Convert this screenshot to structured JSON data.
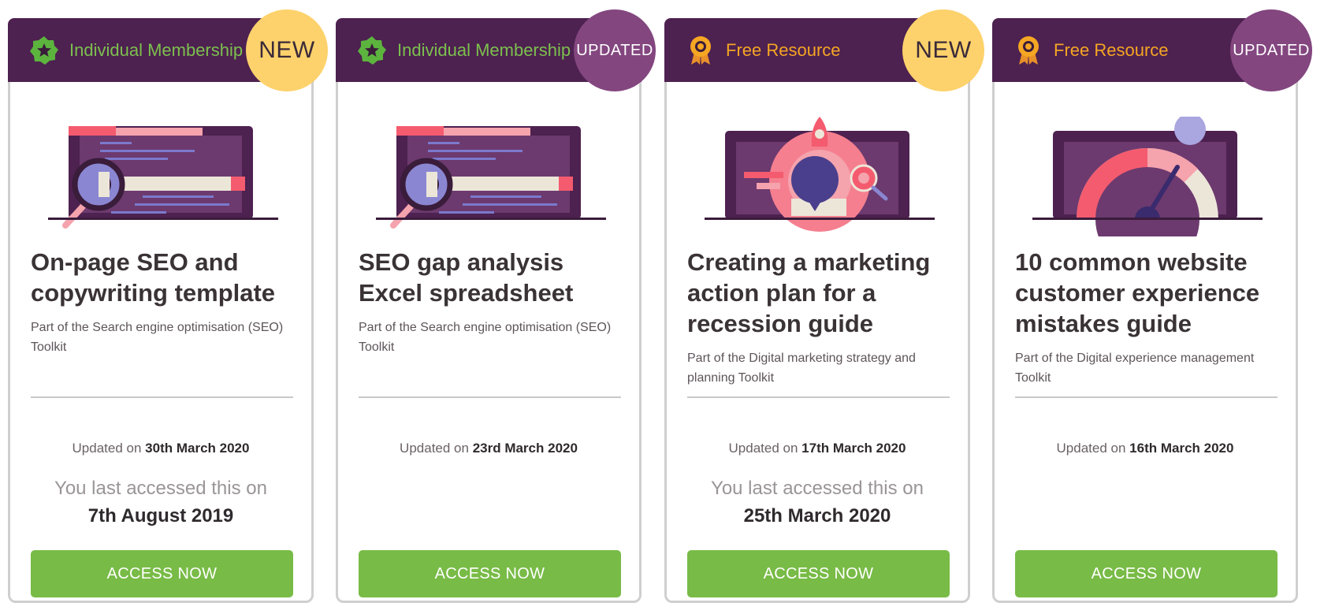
{
  "cards": [
    {
      "type_label": "Individual Membership",
      "type_icon": "star-badge-icon",
      "badge": "NEW",
      "illustration": "seo-magnifier-illustration",
      "title": "On-page SEO and copywriting template",
      "subtitle": "Part of the Search engine optimisation (SEO) Toolkit",
      "updated_prefix": "Updated on",
      "updated_date": "30th March 2020",
      "accessed_text": "You last accessed this on",
      "accessed_date": "7th August 2019",
      "button_label": "ACCESS NOW"
    },
    {
      "type_label": "Individual Membership",
      "type_icon": "star-badge-icon",
      "badge": "UPDATED",
      "illustration": "seo-magnifier-illustration",
      "title": "SEO gap analysis Excel spreadsheet",
      "subtitle": "Part of the Search engine optimisation (SEO) Toolkit",
      "updated_prefix": "Updated on",
      "updated_date": "23rd March 2020",
      "button_label": "ACCESS NOW"
    },
    {
      "type_label": "Free Resource",
      "type_icon": "award-medal-icon",
      "badge": "NEW",
      "illustration": "rocket-strategy-illustration",
      "title": "Creating a marketing action plan for a recession guide",
      "subtitle": "Part of the Digital marketing strategy and planning Toolkit",
      "updated_prefix": "Updated on",
      "updated_date": "17th March 2020",
      "accessed_text": "You last accessed this on",
      "accessed_date": "25th March 2020",
      "button_label": "ACCESS NOW"
    },
    {
      "type_label": "Free Resource",
      "type_icon": "award-medal-icon",
      "badge": "UPDATED",
      "illustration": "gauge-speedometer-illustration",
      "title": "10 common website customer experience mistakes guide",
      "subtitle": "Part of the Digital experience management Toolkit",
      "updated_prefix": "Updated on",
      "updated_date": "16th March 2020",
      "button_label": "ACCESS NOW"
    }
  ],
  "colors": {
    "header_bg": "#4d2150",
    "membership_label": "#7cc04e",
    "free_label": "#f5a623",
    "new_badge": "#fdd26c",
    "updated_badge": "#83467f",
    "button": "#78bb46"
  }
}
